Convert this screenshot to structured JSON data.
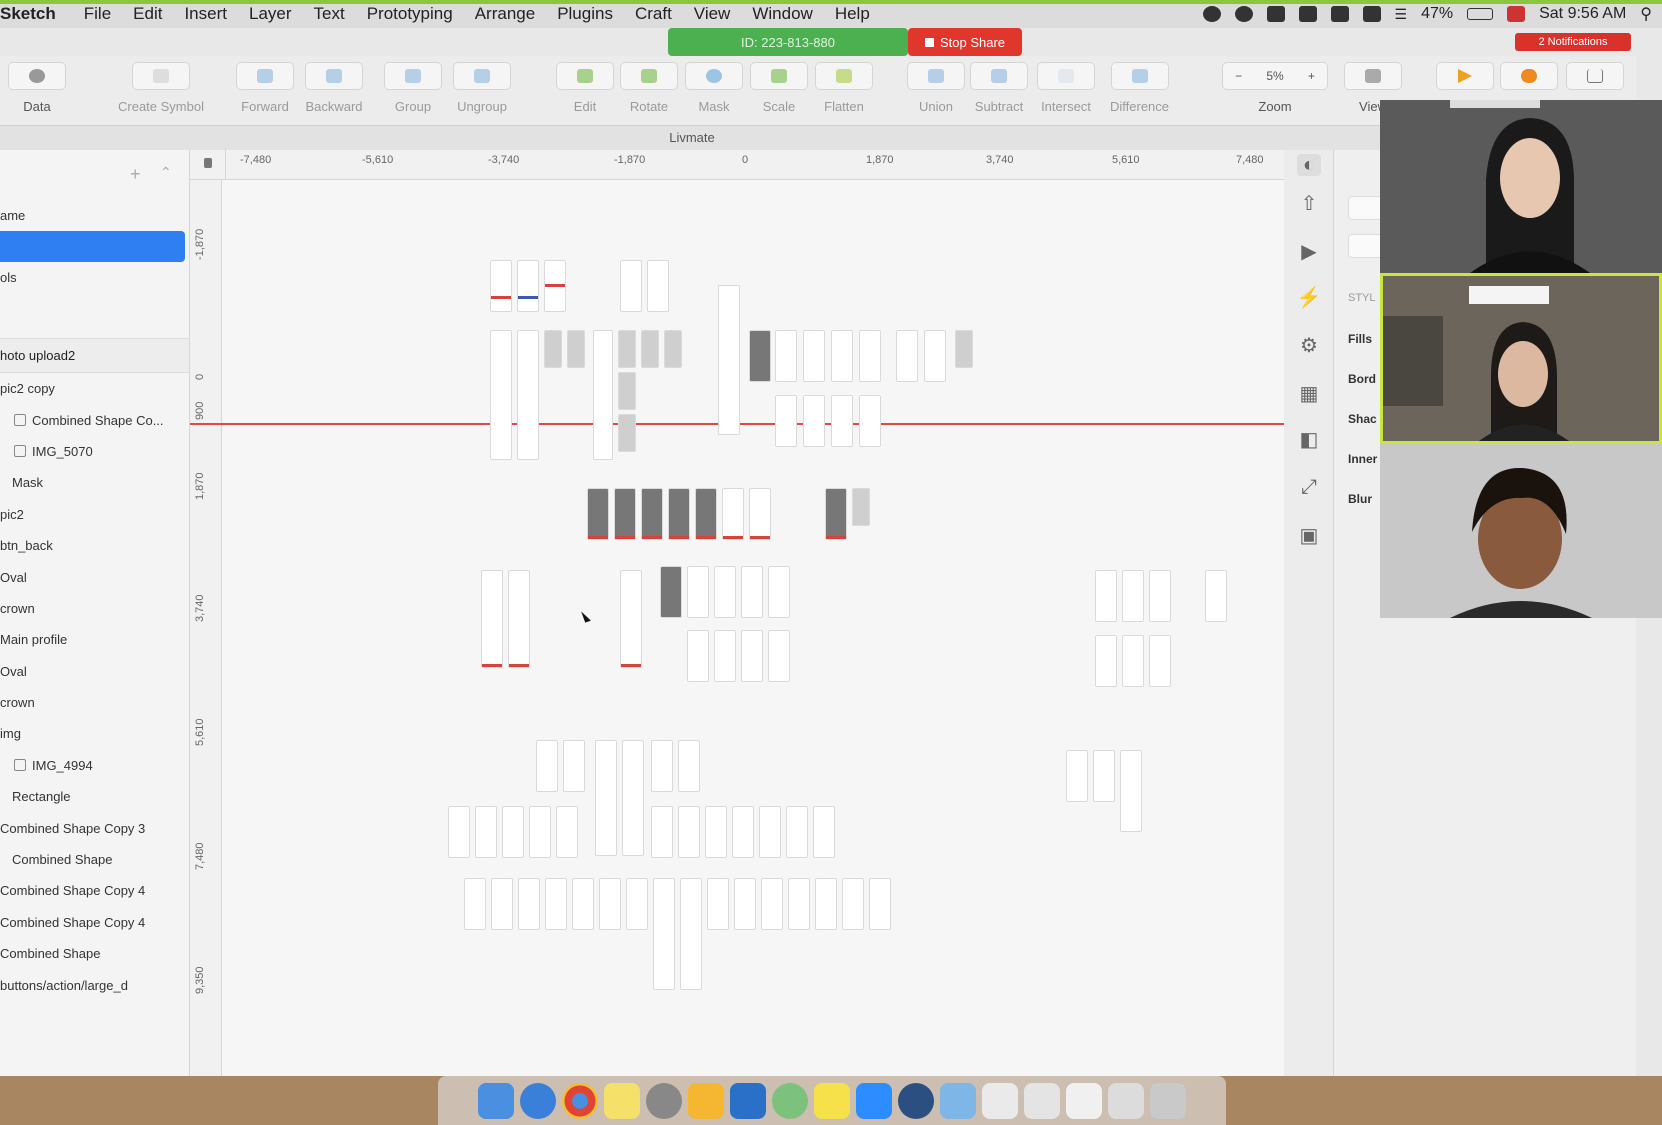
{
  "menubar": {
    "app": "Sketch",
    "items": [
      "File",
      "Edit",
      "Insert",
      "Layer",
      "Text",
      "Prototyping",
      "Arrange",
      "Plugins",
      "Craft",
      "View",
      "Window",
      "Help"
    ],
    "battery": "47%",
    "clock": "Sat 9:56 AM"
  },
  "meeting": {
    "id_label": "ID: 223-813-880",
    "stop_share": "Stop Share",
    "notifications": "2 Notifications"
  },
  "toolbar": {
    "items": [
      {
        "label": "Data",
        "icon": "data-icon"
      },
      {
        "label": "Create Symbol",
        "icon": "create-symbol-icon"
      },
      {
        "label": "Forward",
        "icon": "forward-icon"
      },
      {
        "label": "Backward",
        "icon": "backward-icon"
      },
      {
        "label": "Group",
        "icon": "group-icon"
      },
      {
        "label": "Ungroup",
        "icon": "ungroup-icon"
      },
      {
        "label": "Edit",
        "icon": "edit-icon"
      },
      {
        "label": "Rotate",
        "icon": "rotate-icon"
      },
      {
        "label": "Mask",
        "icon": "mask-icon"
      },
      {
        "label": "Scale",
        "icon": "scale-icon"
      },
      {
        "label": "Flatten",
        "icon": "flatten-icon"
      },
      {
        "label": "Union",
        "icon": "union-icon"
      },
      {
        "label": "Subtract",
        "icon": "subtract-icon"
      },
      {
        "label": "Intersect",
        "icon": "intersect-icon"
      },
      {
        "label": "Difference",
        "icon": "difference-icon"
      },
      {
        "label": "Zoom",
        "icon": "zoom-icon"
      },
      {
        "label": "View",
        "icon": "view-icon"
      }
    ],
    "zoom_value": "5%"
  },
  "document": {
    "title": "Livmate"
  },
  "pages": [
    {
      "label": "ame"
    },
    {
      "label": "",
      "selected": true
    },
    {
      "label": "ols"
    }
  ],
  "layers": {
    "group": "hoto upload2",
    "items": [
      "pic2 copy",
      "Combined Shape Co...",
      "IMG_5070",
      "Mask",
      "pic2",
      "btn_back",
      "Oval",
      "crown",
      "Main profile",
      "Oval",
      "crown",
      "img",
      "IMG_4994",
      "Rectangle",
      "Combined Shape Copy 3",
      "Combined Shape",
      "Combined Shape Copy 4",
      "Combined Shape Copy 4",
      "Combined Shape",
      "buttons/action/large_d"
    ]
  },
  "ruler": {
    "h": [
      "-7,480",
      "-5,610",
      "-3,740",
      "-1,870",
      "0",
      "1,870",
      "3,740",
      "5,610",
      "7,480"
    ],
    "v": [
      "-1,870",
      "0",
      "900",
      "1,870",
      "3,740",
      "5,610",
      "7,480",
      "9,350"
    ]
  },
  "inspector": {
    "labels": [
      "STYL",
      "Fills",
      "Bord",
      "Shac",
      "Inner",
      "Blur"
    ]
  },
  "colors": {
    "selection": "#2f7ff2",
    "meeting_green": "#4caf50",
    "stop_red": "#e0362c",
    "guide_red": "#e04a45",
    "border_green": "#8cc63f"
  }
}
